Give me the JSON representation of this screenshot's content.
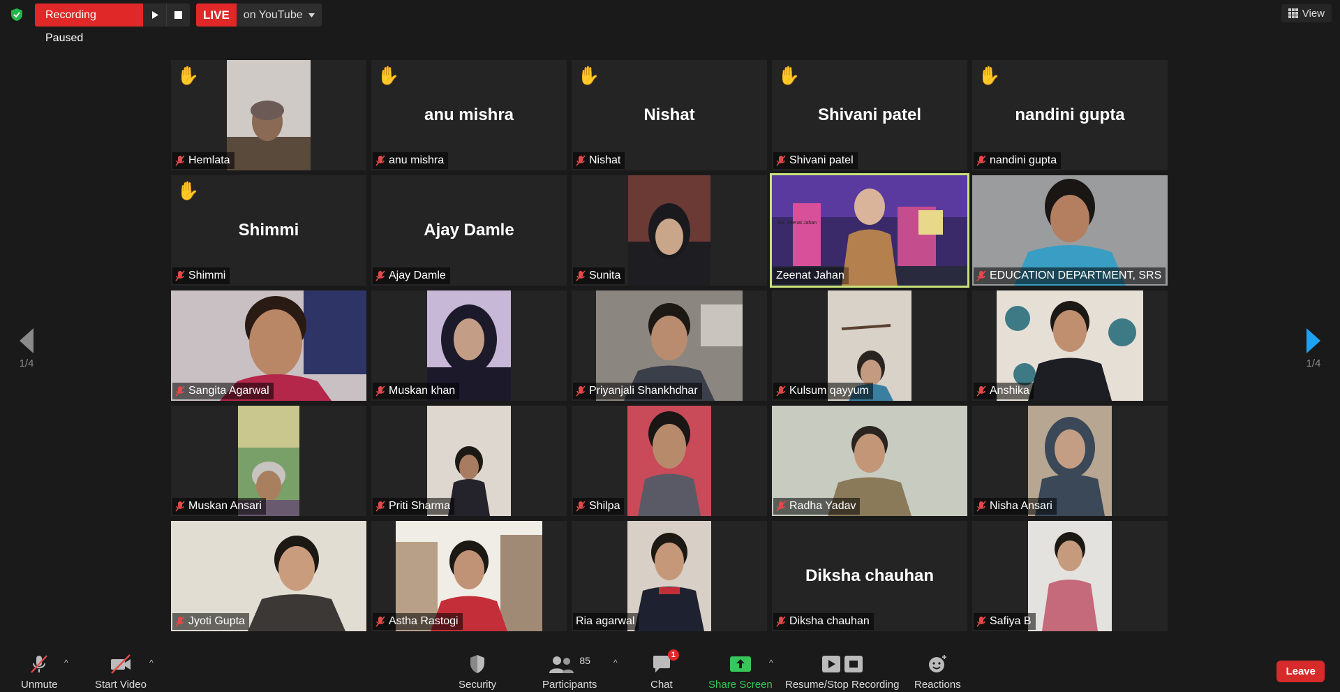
{
  "topbar": {
    "recording_status": "Recording Paused",
    "live_badge": "LIVE",
    "live_target": "on YouTube",
    "view_label": "View"
  },
  "pager": {
    "left_page": "1/4",
    "right_page": "1/4"
  },
  "tiles": [
    {
      "name": "Hemlata",
      "hand_raised": true,
      "has_video": true,
      "muted": true
    },
    {
      "name": "anu mishra",
      "display_name": "anu mishra",
      "hand_raised": true,
      "has_video": false,
      "muted": true
    },
    {
      "name": "Nishat",
      "display_name": "Nishat",
      "hand_raised": true,
      "has_video": false,
      "muted": true
    },
    {
      "name": "Shivani patel",
      "display_name": "Shivani patel",
      "hand_raised": true,
      "has_video": false,
      "muted": true
    },
    {
      "name": "nandini gupta",
      "display_name": "nandini gupta",
      "hand_raised": true,
      "has_video": false,
      "muted": true
    },
    {
      "name": "Shimmi",
      "display_name": "Shimmi",
      "hand_raised": true,
      "has_video": false,
      "muted": true
    },
    {
      "name": "Ajay Damle",
      "display_name": "Ajay Damle",
      "hand_raised": false,
      "has_video": false,
      "muted": true
    },
    {
      "name": "Sunita",
      "hand_raised": false,
      "has_video": true,
      "muted": true
    },
    {
      "name": "Zeenat Jahan",
      "hand_raised": false,
      "has_video": true,
      "muted": false,
      "active_speaker": true,
      "backdrop_text": "Ms. Zeenat Jahan"
    },
    {
      "name": "EDUCATION DEPARTMENT, SRS",
      "hand_raised": false,
      "has_video": true,
      "muted": true
    },
    {
      "name": "Sangita Agarwal",
      "hand_raised": false,
      "has_video": true,
      "muted": true
    },
    {
      "name": "Muskan khan",
      "hand_raised": false,
      "has_video": true,
      "muted": true
    },
    {
      "name": "Priyanjali Shankhdhar",
      "hand_raised": false,
      "has_video": true,
      "muted": true
    },
    {
      "name": "Kulsum qayyum",
      "hand_raised": false,
      "has_video": true,
      "muted": true
    },
    {
      "name": "Anshika",
      "hand_raised": false,
      "has_video": true,
      "muted": true
    },
    {
      "name": "Muskan Ansari",
      "hand_raised": false,
      "has_video": true,
      "muted": true
    },
    {
      "name": "Priti Sharma",
      "hand_raised": false,
      "has_video": true,
      "muted": true
    },
    {
      "name": "Shilpa",
      "hand_raised": false,
      "has_video": true,
      "muted": true
    },
    {
      "name": "Radha Yadav",
      "hand_raised": false,
      "has_video": true,
      "muted": true
    },
    {
      "name": "Nisha Ansari",
      "hand_raised": false,
      "has_video": true,
      "muted": true
    },
    {
      "name": "Jyoti Gupta",
      "hand_raised": false,
      "has_video": true,
      "muted": true
    },
    {
      "name": "Astha Rastogi",
      "hand_raised": false,
      "has_video": true,
      "muted": true
    },
    {
      "name": "Ria agarwal",
      "hand_raised": false,
      "has_video": true,
      "muted": false
    },
    {
      "name": "Diksha chauhan",
      "display_name": "Diksha chauhan",
      "hand_raised": false,
      "has_video": false,
      "muted": true
    },
    {
      "name": "Safiya B",
      "hand_raised": false,
      "has_video": true,
      "muted": true
    }
  ],
  "toolbar": {
    "unmute": "Unmute",
    "start_video": "Start Video",
    "security": "Security",
    "participants": "Participants",
    "participant_count": "85",
    "chat": "Chat",
    "chat_badge": "1",
    "share_screen": "Share Screen",
    "recording": "Resume/Stop Recording",
    "reactions": "Reactions",
    "leave": "Leave"
  },
  "colors": {
    "background": "#1a1a1a",
    "tile": "#242424",
    "recording_red": "#e02828",
    "active_speaker": "#c8e27a",
    "share_green": "#35c759",
    "pager_arrow_right": "#1ea1f2"
  }
}
